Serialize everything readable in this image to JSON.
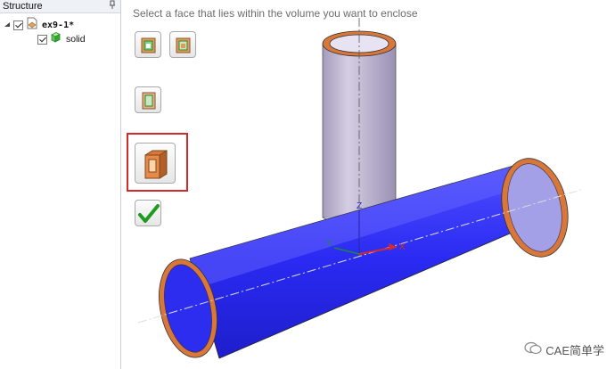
{
  "structure_panel": {
    "title": "Structure",
    "pin_glyph": " p",
    "items": [
      {
        "label": "ex9-1*",
        "icon": "part-document-icon",
        "checked": true
      },
      {
        "label": "solid",
        "icon": "solid-body-icon",
        "checked": true
      }
    ]
  },
  "viewport": {
    "instruction": "Select a face that lies within the volume you want to enclose",
    "tools": [
      {
        "name": "select-body-tool",
        "icon": "box-select-icon"
      },
      {
        "name": "select-body-alt-tool",
        "icon": "box-select-alt-icon"
      },
      {
        "name": "cap-face-tool",
        "icon": "cap-face-icon"
      },
      {
        "name": "enclose-volume-tool",
        "icon": "enclose-volume-icon",
        "highlighted": true
      },
      {
        "name": "complete-tool",
        "icon": "checkmark-icon"
      }
    ],
    "axis_labels": {
      "z": "Z",
      "x": "X",
      "y": "Y"
    },
    "colors": {
      "fluid_volume": "#2c2cf0",
      "pipe_wall": "#b9b2cc",
      "pipe_rim": "#d9773a",
      "highlight": "#d22a2a"
    }
  },
  "watermark": {
    "text": "CAE简单学",
    "icon": "wechat-icon"
  }
}
